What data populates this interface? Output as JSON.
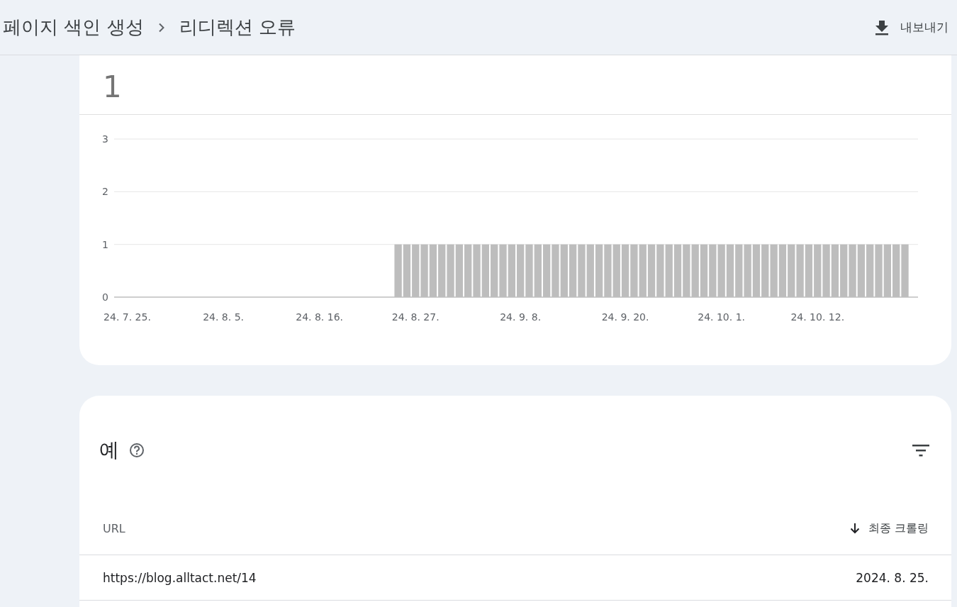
{
  "breadcrumb": [
    "페이지 색인 생성",
    "리디렉션 오류"
  ],
  "export_button": {
    "label": "내보내기"
  },
  "summary": {
    "value": "1",
    "chart_data": {
      "type": "bar",
      "ylim": [
        0,
        3
      ],
      "yticks": [
        0,
        1,
        2,
        3
      ],
      "categories": [
        null,
        "24. 7. 25.",
        null,
        null,
        null,
        null,
        null,
        null,
        null,
        null,
        null,
        null,
        "24. 8. 5.",
        null,
        null,
        null,
        null,
        null,
        null,
        null,
        null,
        null,
        null,
        "24. 8. 16.",
        null,
        null,
        null,
        null,
        null,
        null,
        null,
        null,
        null,
        null,
        "24. 8. 27.",
        null,
        null,
        null,
        null,
        null,
        null,
        null,
        null,
        null,
        null,
        null,
        "24. 9. 8.",
        null,
        null,
        null,
        null,
        null,
        null,
        null,
        null,
        null,
        null,
        null,
        "24. 9. 20.",
        null,
        null,
        null,
        null,
        null,
        null,
        null,
        null,
        null,
        null,
        "24. 10. 1.",
        null,
        null,
        null,
        null,
        null,
        null,
        null,
        null,
        null,
        null,
        "24. 10. 12.",
        null,
        null,
        null,
        null,
        null,
        null,
        null,
        null,
        null,
        null,
        null
      ],
      "series": [
        {
          "color": "#bdbdbd",
          "values": [
            0,
            0,
            0,
            0,
            0,
            0,
            0,
            0,
            0,
            0,
            0,
            0,
            0,
            0,
            0,
            0,
            0,
            0,
            0,
            0,
            0,
            0,
            0,
            0,
            0,
            0,
            0,
            0,
            0,
            0,
            0,
            0,
            1,
            1,
            1,
            1,
            1,
            1,
            1,
            1,
            1,
            1,
            1,
            1,
            1,
            1,
            1,
            1,
            1,
            1,
            1,
            1,
            1,
            1,
            1,
            1,
            1,
            1,
            1,
            1,
            1,
            1,
            1,
            1,
            1,
            1,
            1,
            1,
            1,
            1,
            1,
            1,
            1,
            1,
            1,
            1,
            1,
            1,
            1,
            1,
            1,
            1,
            1,
            1,
            1,
            1,
            1,
            1,
            1,
            1,
            1,
            0
          ]
        }
      ]
    }
  },
  "examples": {
    "title": "예",
    "table": {
      "columns": [
        {
          "label": "URL",
          "sorted": false
        },
        {
          "label": "최종 크롤링",
          "sorted": true
        }
      ],
      "rows": [
        {
          "url": "https://blog.alltact.net/14",
          "last_crawled": "2024. 8. 25."
        }
      ]
    }
  }
}
